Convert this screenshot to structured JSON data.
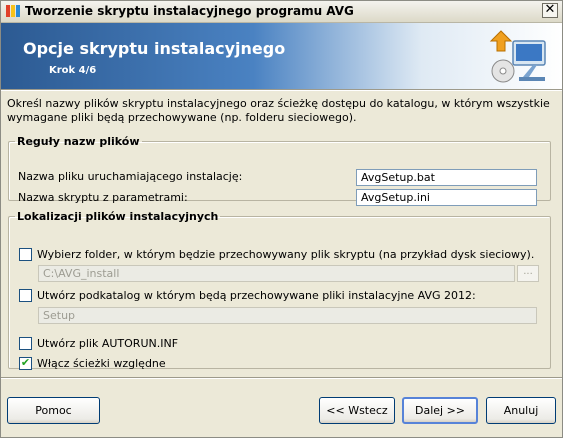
{
  "window": {
    "title": "Tworzenie skryptu instalacyjnego programu AVG",
    "close_glyph": "✕"
  },
  "banner": {
    "title": "Opcje skryptu instalacyjnego",
    "step": "Krok 4/6",
    "icon": "install-script-icon"
  },
  "intro": "Określ nazwy plików skryptu instalacyjnego oraz ścieżkę dostępu do katalogu, w którym wszystkie wymagane pliki będą przechowywane (np. folderu sieciowego).",
  "file_names": {
    "legend": "Reguły nazw plików",
    "launcher_label": "Nazwa pliku uruchamiającego instalację:",
    "launcher_value": "AvgSetup.bat",
    "params_label": "Nazwa skryptu z parametrami:",
    "params_value": "AvgSetup.ini"
  },
  "locations": {
    "legend": "Lokalizacji plików instalacyjnych",
    "choose_folder_label": "Wybierz folder, w którym będzie przechowywany plik skryptu (na przykład dysk sieciowy).",
    "choose_folder_checked": false,
    "folder_value": "C:\\AVG_install",
    "browse_label": "...",
    "subdir_label": "Utwórz podkatalog w którym będą przechowywane pliki instalacyjne AVG 2012:",
    "subdir_checked": false,
    "subdir_value": "Setup",
    "autorun_label": "Utwórz plik AUTORUN.INF",
    "autorun_checked": false,
    "relative_label": "Włącz ścieżki względne",
    "relative_checked": true
  },
  "buttons": {
    "help": "Pomoc",
    "back": "<< Wstecz",
    "next": "Dalej >>",
    "cancel": "Anuluj"
  },
  "colors": {
    "banner_dark": "#2c5a92",
    "check_mark": "#21a121",
    "default_button_border": "#5783d8"
  }
}
